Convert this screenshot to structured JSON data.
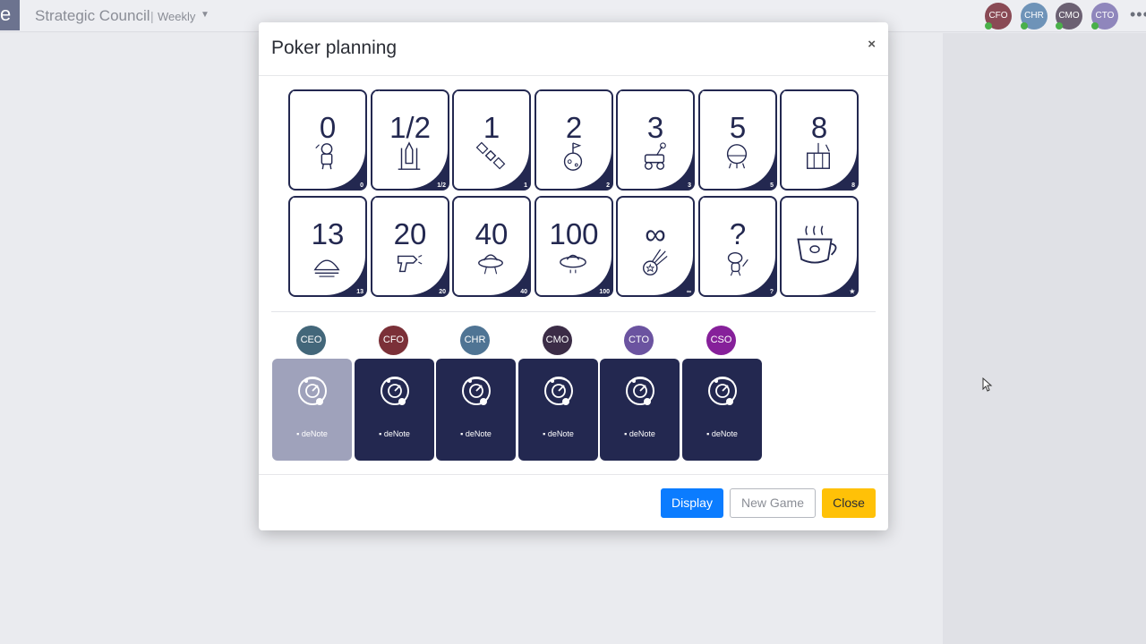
{
  "app": {
    "logo_letter": "e",
    "title": "Strategic Council",
    "separator": "|",
    "subtitle": "Weekly",
    "more": "•••",
    "presence": [
      {
        "initials": "CFO",
        "color": "#8a4a55"
      },
      {
        "initials": "CHR",
        "color": "#6e93b8"
      },
      {
        "initials": "CMO",
        "color": "#6b6072"
      },
      {
        "initials": "CTO",
        "color": "#8f86bc"
      }
    ]
  },
  "modal": {
    "title": "Poker planning",
    "close": "×",
    "cards": [
      {
        "value": "0",
        "icon": "astronaut-icon"
      },
      {
        "value": "1/2",
        "icon": "rocket-launch-icon"
      },
      {
        "value": "1",
        "icon": "satellite-icon"
      },
      {
        "value": "2",
        "icon": "moon-flag-icon"
      },
      {
        "value": "3",
        "icon": "moon-rover-icon"
      },
      {
        "value": "5",
        "icon": "space-pod-icon"
      },
      {
        "value": "8",
        "icon": "space-station-icon"
      },
      {
        "value": "13",
        "icon": "moon-base-icon"
      },
      {
        "value": "20",
        "icon": "ray-gun-icon"
      },
      {
        "value": "40",
        "icon": "alien-ship-icon"
      },
      {
        "value": "100",
        "icon": "ufo-icon"
      },
      {
        "value": "∞",
        "icon": "comet-icon"
      },
      {
        "value": "?",
        "icon": "alien-question-icon"
      },
      {
        "value": "",
        "corner": "★",
        "icon": "coffee-cup-icon"
      }
    ],
    "votes": [
      {
        "initials": "CEO",
        "color": "#43677a",
        "state": "pending",
        "brand": "deNote"
      },
      {
        "initials": "CFO",
        "color": "#7b3038",
        "state": "voted",
        "brand": "deNote"
      },
      {
        "initials": "CHR",
        "color": "#4f7494",
        "state": "voted",
        "brand": "deNote"
      },
      {
        "initials": "CMO",
        "color": "#3b2c46",
        "state": "voted",
        "brand": "deNote"
      },
      {
        "initials": "CTO",
        "color": "#6b53a0",
        "state": "voted",
        "brand": "deNote"
      },
      {
        "initials": "CSO",
        "color": "#86209a",
        "state": "voted",
        "brand": "deNote"
      }
    ],
    "buttons": {
      "display": "Display",
      "new_game": "New Game",
      "close": "Close"
    }
  }
}
